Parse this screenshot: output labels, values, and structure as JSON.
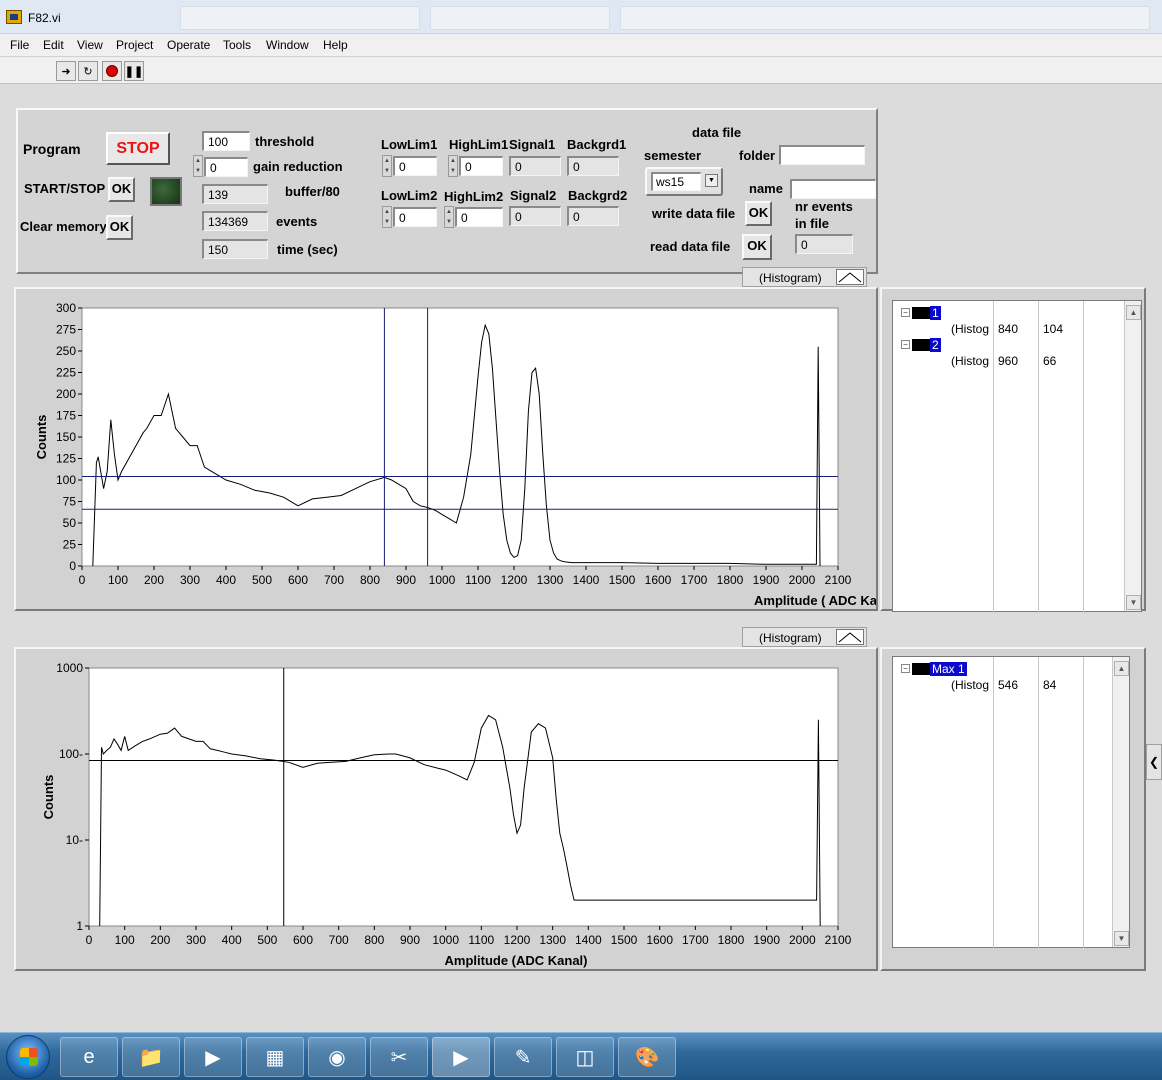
{
  "window": {
    "title": "F82.vi"
  },
  "menu": [
    "File",
    "Edit",
    "View",
    "Project",
    "Operate",
    "Tools",
    "Window",
    "Help"
  ],
  "toolbar": {
    "run_icon": "run-arrow-icon",
    "run_continuous_icon": "run-continuous-icon",
    "abort_icon": "abort-icon",
    "pause_icon": "pause-icon"
  },
  "controls": {
    "program_label": "Program",
    "stop_label": "STOP",
    "startstop_label": "START/STOP",
    "clear_label": "Clear memory",
    "ok": "OK",
    "threshold_value": "100",
    "threshold_label": "threshold",
    "gain_value": "0",
    "gain_label": "gain reduction",
    "buffer_value": "139",
    "buffer_label": "buffer/80",
    "events_value": "134369",
    "events_label": "events",
    "time_value": "150",
    "time_label": "time (sec)",
    "lowlim1_label": "LowLim1",
    "lowlim1_value": "0",
    "highlim1_label": "HighLim1",
    "highlim1_value": "0",
    "signal1_label": "Signal1",
    "signal1_value": "0",
    "backgrd1_label": "Backgrd1",
    "backgrd1_value": "0",
    "lowlim2_label": "LowLim2",
    "lowlim2_value": "0",
    "highlim2_label": "HighLim2",
    "highlim2_value": "0",
    "signal2_label": "Signal2",
    "signal2_value": "0",
    "backgrd2_label": "Backgrd2",
    "backgrd2_value": "0",
    "datafile_label": "data file",
    "semester_label": "semester",
    "semester_value": "ws15",
    "folder_label": "folder",
    "folder_value": "",
    "name_label": "name",
    "name_value": "",
    "write_label": "write data file",
    "read_label": "read data file",
    "nrevents_label": "nr events",
    "infile_label": "in file",
    "nrevents_value": "0"
  },
  "legend_label": "(Histogram)",
  "cursors_top": {
    "rows": [
      {
        "name": "1",
        "plot": "(Histog",
        "x": "840",
        "y": "104"
      },
      {
        "name": "2",
        "plot": "(Histog",
        "x": "960",
        "y": "66"
      }
    ]
  },
  "cursors_bottom": {
    "rows": [
      {
        "name": "Max 1",
        "plot": "(Histog",
        "x": "546",
        "y": "84"
      }
    ]
  },
  "chart_data": [
    {
      "type": "line",
      "xlabel": "Amplitude ( ADC Ka",
      "ylabel": "Counts",
      "xlim": [
        0,
        2100
      ],
      "ylim": [
        0,
        300
      ],
      "xticks": [
        0,
        100,
        200,
        300,
        400,
        500,
        600,
        700,
        800,
        900,
        1000,
        1100,
        1200,
        1300,
        1400,
        1500,
        1600,
        1700,
        1800,
        1900,
        2000,
        2100
      ],
      "yticks": [
        0,
        25,
        50,
        75,
        100,
        125,
        150,
        175,
        200,
        225,
        250,
        275,
        300
      ],
      "cursors": [
        {
          "x": 840,
          "y": 104
        },
        {
          "x": 960,
          "y": 66
        }
      ],
      "grid": false,
      "series": [
        {
          "x": [
            30,
            40,
            45,
            60,
            70,
            80,
            90,
            100,
            110,
            130,
            150,
            170,
            180,
            200,
            220,
            240,
            260,
            280,
            300,
            320,
            340,
            360,
            380,
            400,
            440,
            480,
            520,
            560,
            600,
            640,
            680,
            720,
            760,
            800,
            840,
            860,
            880,
            900,
            920,
            940,
            960,
            980,
            1000,
            1020,
            1040,
            1060,
            1080,
            1100,
            1110,
            1120,
            1130,
            1140,
            1150,
            1160,
            1170,
            1180,
            1190,
            1200,
            1210,
            1220,
            1230,
            1240,
            1250,
            1260,
            1270,
            1280,
            1290,
            1300,
            1310,
            1320,
            1330,
            1340,
            1360,
            1400,
            1500,
            1600,
            1700,
            1800,
            1900,
            2000,
            2040,
            2045,
            2050
          ],
          "values": [
            0,
            120,
            127,
            90,
            110,
            170,
            130,
            100,
            110,
            125,
            140,
            155,
            160,
            175,
            175,
            200,
            160,
            150,
            140,
            140,
            115,
            110,
            105,
            100,
            95,
            88,
            85,
            80,
            70,
            78,
            80,
            82,
            90,
            98,
            103,
            100,
            95,
            90,
            75,
            70,
            68,
            65,
            60,
            55,
            50,
            80,
            130,
            220,
            260,
            280,
            270,
            230,
            170,
            110,
            60,
            30,
            15,
            10,
            12,
            30,
            90,
            180,
            225,
            230,
            200,
            130,
            70,
            30,
            15,
            8,
            6,
            5,
            4,
            4,
            4,
            3,
            3,
            3,
            2,
            2,
            2,
            255,
            0
          ]
        }
      ]
    },
    {
      "type": "line",
      "scale": "log",
      "xlabel": "Amplitude (ADC Kanal)",
      "ylabel": "Counts",
      "xlim": [
        0,
        2100
      ],
      "ylim": [
        1,
        1000
      ],
      "xticks": [
        0,
        100,
        200,
        300,
        400,
        500,
        600,
        700,
        800,
        900,
        1000,
        1100,
        1200,
        1300,
        1400,
        1500,
        1600,
        1700,
        1800,
        1900,
        2000,
        2100
      ],
      "yticks": [
        1,
        10,
        100,
        1000
      ],
      "ytick_labels": [
        "1",
        "10-",
        "100-",
        "1000"
      ],
      "cursors": [
        {
          "x": 546,
          "y": 84
        }
      ],
      "grid": false,
      "series": [
        {
          "x": [
            30,
            35,
            40,
            50,
            60,
            70,
            80,
            90,
            100,
            110,
            130,
            150,
            170,
            200,
            220,
            240,
            260,
            280,
            300,
            320,
            340,
            360,
            380,
            400,
            440,
            480,
            520,
            560,
            600,
            640,
            680,
            720,
            760,
            800,
            840,
            860,
            880,
            900,
            940,
            980,
            1000,
            1040,
            1060,
            1080,
            1100,
            1120,
            1140,
            1160,
            1180,
            1190,
            1200,
            1210,
            1220,
            1240,
            1260,
            1280,
            1300,
            1310,
            1320,
            1330,
            1340,
            1350,
            1360,
            1400,
            1500,
            1600,
            1700,
            1800,
            1900,
            2000,
            2040,
            2045,
            2050
          ],
          "values": [
            1,
            120,
            100,
            110,
            120,
            150,
            130,
            110,
            160,
            110,
            125,
            140,
            150,
            170,
            175,
            200,
            160,
            150,
            140,
            140,
            115,
            110,
            105,
            100,
            95,
            88,
            85,
            80,
            70,
            78,
            80,
            82,
            90,
            98,
            100,
            100,
            95,
            90,
            75,
            68,
            65,
            55,
            50,
            80,
            200,
            280,
            250,
            120,
            40,
            20,
            12,
            15,
            40,
            180,
            225,
            200,
            90,
            30,
            12,
            8,
            5,
            3,
            2,
            2,
            2,
            2,
            2,
            2,
            2,
            2,
            2,
            250,
            1
          ]
        }
      ]
    }
  ]
}
